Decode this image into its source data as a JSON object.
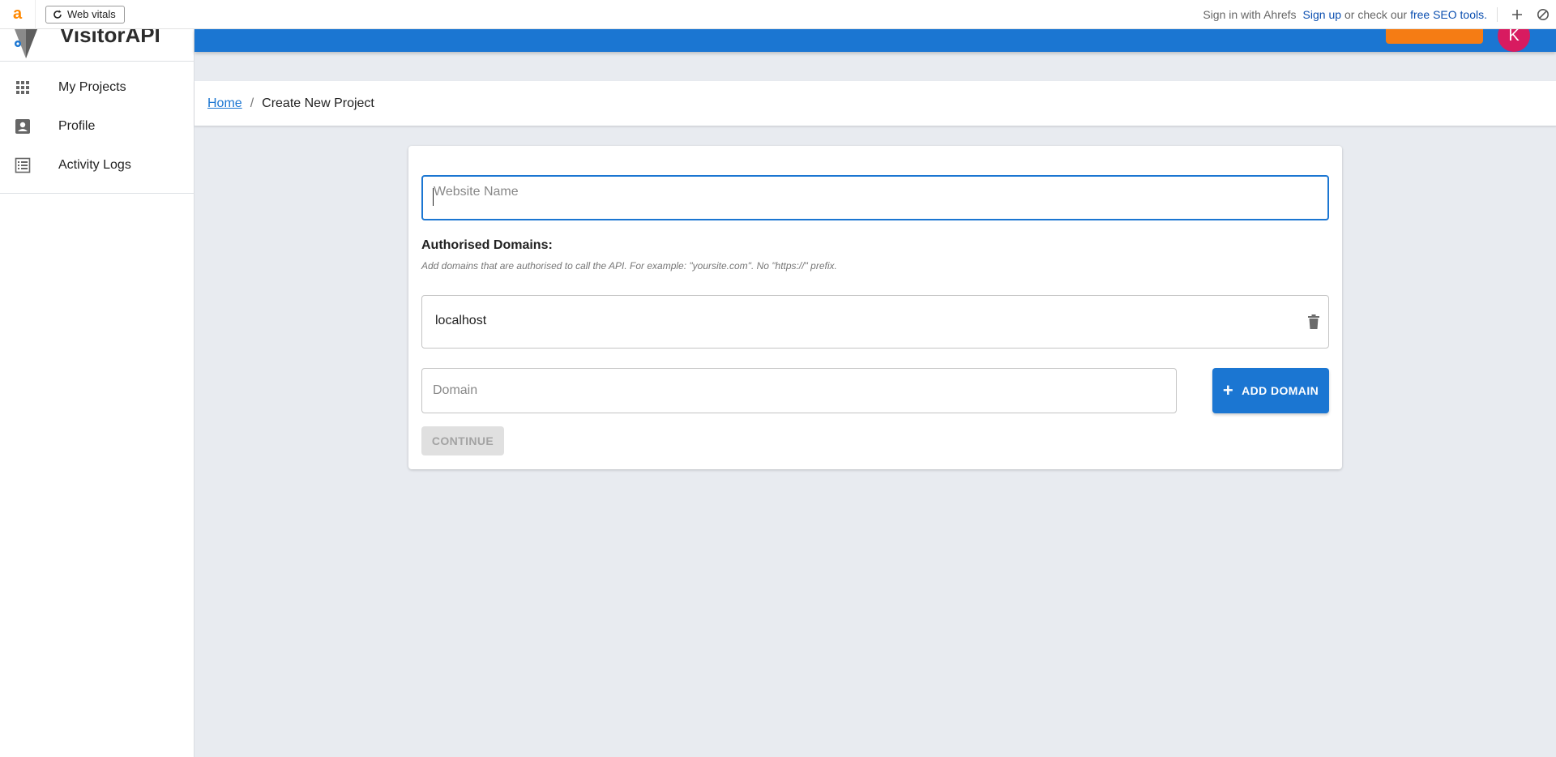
{
  "extension_bar": {
    "logo": "a",
    "web_vitals_label": "Web vitals",
    "sign_in_text": "Sign in with Ahrefs",
    "sign_up_link": "Sign up",
    "or_check_text": "or check our",
    "free_tools_link": "free SEO tools.",
    "colors": {
      "logo": "#ff8800",
      "link": "#0b4fb0"
    }
  },
  "sidebar": {
    "brand_name": "VisitorAPI",
    "items": [
      {
        "label": "My Projects",
        "icon": "apps-grid-icon"
      },
      {
        "label": "Profile",
        "icon": "profile-badge-icon"
      },
      {
        "label": "Activity Logs",
        "icon": "list-icon"
      }
    ]
  },
  "appbar": {
    "avatar_initial": "K",
    "colors": {
      "bar": "#1b76d2",
      "support": "#f57c14",
      "avatar": "#d81b60"
    }
  },
  "breadcrumb": {
    "home": "Home",
    "separator": "/",
    "current": "Create New Project"
  },
  "form": {
    "website_name_placeholder": "Website Name",
    "authorised_title": "Authorised Domains:",
    "authorised_help": "Add domains that are authorised to call the API. For example: \"yoursite.com\". No \"https://\" prefix.",
    "domains": [
      "localhost"
    ],
    "domain_placeholder": "Domain",
    "add_domain_label": "ADD DOMAIN",
    "continue_label": "CONTINUE"
  }
}
